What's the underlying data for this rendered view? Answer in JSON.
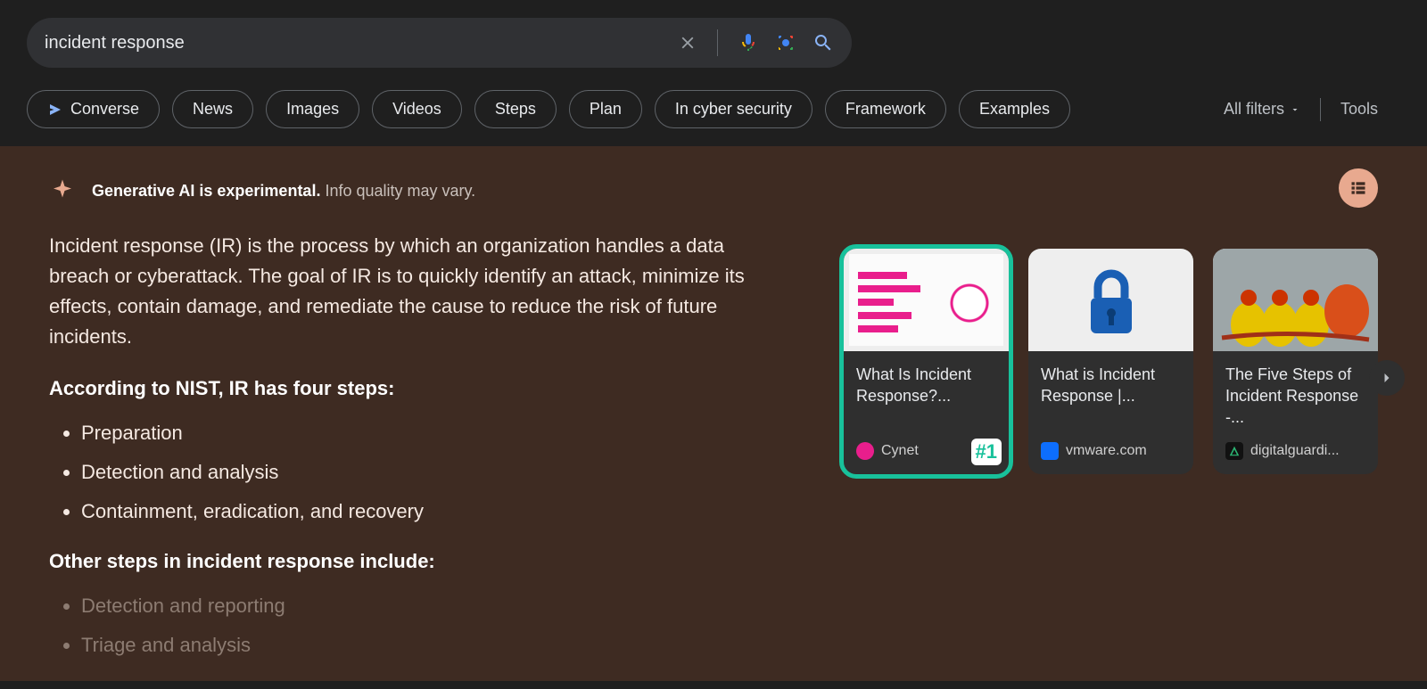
{
  "search": {
    "query": "incident response"
  },
  "chips": {
    "converse": "Converse",
    "news": "News",
    "images": "Images",
    "videos": "Videos",
    "steps": "Steps",
    "plan": "Plan",
    "cyber": "In cyber security",
    "framework": "Framework",
    "examples": "Examples"
  },
  "right": {
    "allfilters": "All filters",
    "tools": "Tools"
  },
  "ai": {
    "label_bold": "Generative AI is experimental.",
    "label_rest": " Info quality may vary.",
    "summary": "Incident response (IR) is the process by which an organization handles a data breach or cyberattack. The goal of IR is to quickly identify an attack, minimize its effects, contain damage, and remediate the cause to reduce the risk of future incidents.",
    "heading1": "According to NIST, IR has four steps:",
    "list1": {
      "a": "Preparation",
      "b": "Detection and analysis",
      "c": "Containment, eradication, and recovery"
    },
    "heading2": "Other steps in incident response include:",
    "list2": {
      "a": "Detection and reporting",
      "b": "Triage and analysis"
    }
  },
  "cards": {
    "c1": {
      "title": "What Is Incident Response?...",
      "source": "Cynet",
      "badge": "#1"
    },
    "c2": {
      "title": "What is Incident Response |...",
      "source": "vmware.com"
    },
    "c3": {
      "title": "The Five Steps of Incident Response -...",
      "source": "digitalguardi..."
    }
  }
}
